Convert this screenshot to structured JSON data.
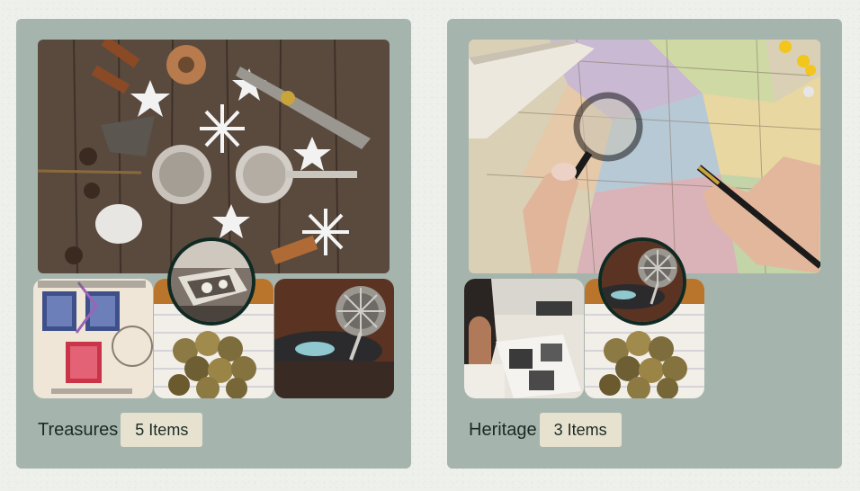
{
  "collections": [
    {
      "name": "Treasures",
      "count_label": "5 Items"
    },
    {
      "name": "Heritage",
      "count_label": "3 Items"
    }
  ]
}
